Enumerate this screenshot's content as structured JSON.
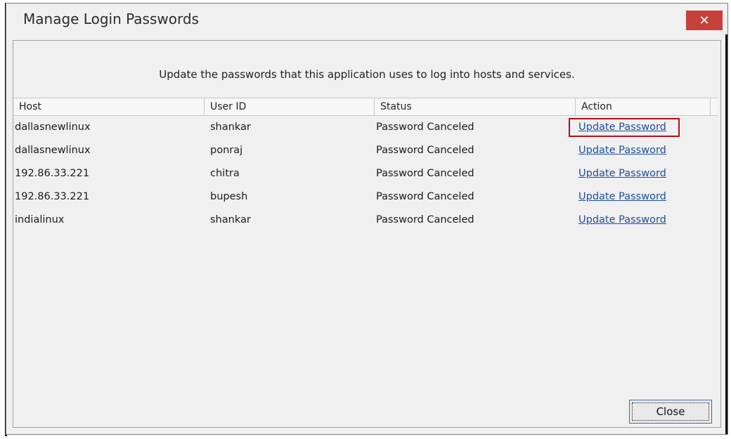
{
  "window": {
    "title": "Manage Login Passwords",
    "close_glyph": "✕"
  },
  "description": "Update the passwords that this application uses to log into hosts and services.",
  "table": {
    "columns": [
      "Host",
      "User ID",
      "Status",
      "Action"
    ],
    "rows": [
      {
        "host": "dallasnewlinux",
        "user_id": "shankar",
        "status": "Password Canceled",
        "action": "Update Password"
      },
      {
        "host": "dallasnewlinux",
        "user_id": "ponraj",
        "status": "Password Canceled",
        "action": "Update Password"
      },
      {
        "host": "192.86.33.221",
        "user_id": "chitra",
        "status": "Password Canceled",
        "action": "Update Password"
      },
      {
        "host": "192.86.33.221",
        "user_id": "bupesh",
        "status": "Password Canceled",
        "action": "Update Password"
      },
      {
        "host": "indialinux",
        "user_id": "shankar",
        "status": "Password Canceled",
        "action": "Update Password"
      }
    ]
  },
  "buttons": {
    "close_label": "Close"
  },
  "colors": {
    "close_button_red": "#c7403a",
    "link_blue": "#1e4f9c",
    "highlight_red": "#b30f1c"
  }
}
